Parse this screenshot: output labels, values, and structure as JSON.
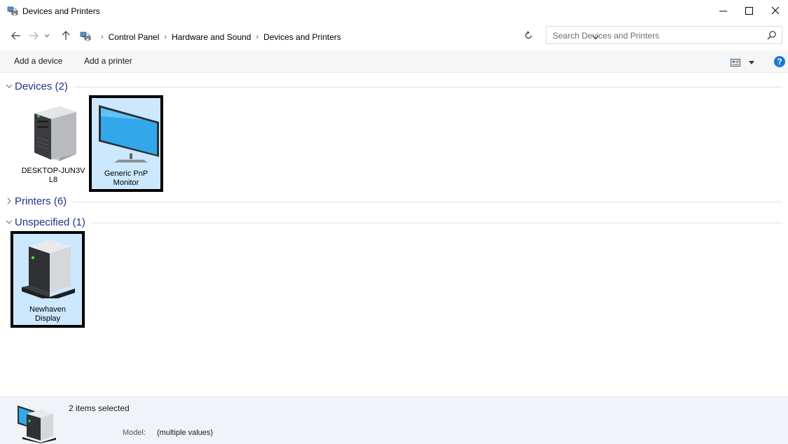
{
  "window": {
    "title": "Devices and Printers",
    "minimize_glyph": "—",
    "maximize_glyph": "☐",
    "close_glyph": "✕"
  },
  "nav": {
    "back_glyph": "←",
    "forward_glyph": "→",
    "recent_glyph": "⌄",
    "up_glyph": "↑"
  },
  "address": {
    "breadcrumbs": [
      "Control Panel",
      "Hardware and Sound",
      "Devices and Printers"
    ],
    "separator": "›"
  },
  "search": {
    "placeholder": "Search Devices and Printers"
  },
  "toolbar": {
    "add_device_label": "Add a device",
    "add_printer_label": "Add a printer",
    "help_label": "?"
  },
  "groups": {
    "devices": {
      "title": "Devices (2)",
      "expanded": true,
      "items": [
        {
          "label_line1": "DESKTOP-JUN3V",
          "label_line2": "L8",
          "selected": false,
          "icon": "computer-tower-icon"
        },
        {
          "label_line1": "Generic PnP",
          "label_line2": "Monitor",
          "selected": true,
          "icon": "monitor-icon"
        }
      ]
    },
    "printers": {
      "title": "Printers (6)",
      "expanded": false
    },
    "unspecified": {
      "title": "Unspecified (1)",
      "expanded": true,
      "items": [
        {
          "label_line1": "Newhaven",
          "label_line2": "Display",
          "selected": true,
          "icon": "generic-device-icon"
        }
      ]
    }
  },
  "details": {
    "count_text": "2 items selected",
    "model_label": "Model:",
    "model_value": "(multiple values)"
  },
  "colors": {
    "selection_fill": "#cce8ff",
    "group_title": "#1e3287",
    "command_bar": "#f5f6f7",
    "details_pane": "#f0f4f9",
    "help_blue": "#1b79d6"
  }
}
